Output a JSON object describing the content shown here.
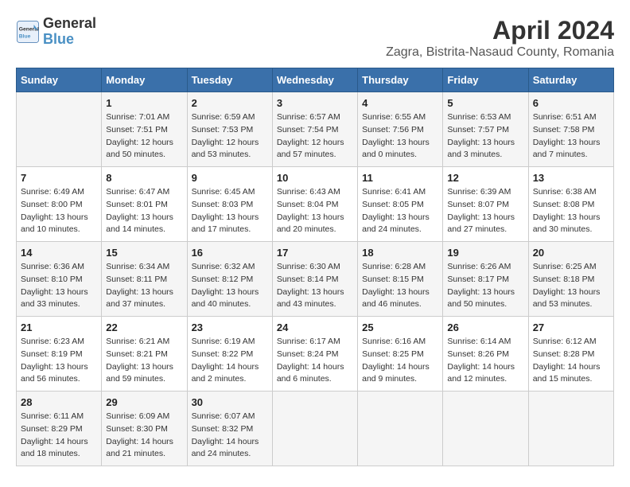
{
  "logo": {
    "name1": "General",
    "name2": "Blue"
  },
  "title": "April 2024",
  "subtitle": "Zagra, Bistrita-Nasaud County, Romania",
  "days_of_week": [
    "Sunday",
    "Monday",
    "Tuesday",
    "Wednesday",
    "Thursday",
    "Friday",
    "Saturday"
  ],
  "weeks": [
    [
      {
        "day": "",
        "detail": ""
      },
      {
        "day": "1",
        "detail": "Sunrise: 7:01 AM\nSunset: 7:51 PM\nDaylight: 12 hours\nand 50 minutes."
      },
      {
        "day": "2",
        "detail": "Sunrise: 6:59 AM\nSunset: 7:53 PM\nDaylight: 12 hours\nand 53 minutes."
      },
      {
        "day": "3",
        "detail": "Sunrise: 6:57 AM\nSunset: 7:54 PM\nDaylight: 12 hours\nand 57 minutes."
      },
      {
        "day": "4",
        "detail": "Sunrise: 6:55 AM\nSunset: 7:56 PM\nDaylight: 13 hours\nand 0 minutes."
      },
      {
        "day": "5",
        "detail": "Sunrise: 6:53 AM\nSunset: 7:57 PM\nDaylight: 13 hours\nand 3 minutes."
      },
      {
        "day": "6",
        "detail": "Sunrise: 6:51 AM\nSunset: 7:58 PM\nDaylight: 13 hours\nand 7 minutes."
      }
    ],
    [
      {
        "day": "7",
        "detail": "Sunrise: 6:49 AM\nSunset: 8:00 PM\nDaylight: 13 hours\nand 10 minutes."
      },
      {
        "day": "8",
        "detail": "Sunrise: 6:47 AM\nSunset: 8:01 PM\nDaylight: 13 hours\nand 14 minutes."
      },
      {
        "day": "9",
        "detail": "Sunrise: 6:45 AM\nSunset: 8:03 PM\nDaylight: 13 hours\nand 17 minutes."
      },
      {
        "day": "10",
        "detail": "Sunrise: 6:43 AM\nSunset: 8:04 PM\nDaylight: 13 hours\nand 20 minutes."
      },
      {
        "day": "11",
        "detail": "Sunrise: 6:41 AM\nSunset: 8:05 PM\nDaylight: 13 hours\nand 24 minutes."
      },
      {
        "day": "12",
        "detail": "Sunrise: 6:39 AM\nSunset: 8:07 PM\nDaylight: 13 hours\nand 27 minutes."
      },
      {
        "day": "13",
        "detail": "Sunrise: 6:38 AM\nSunset: 8:08 PM\nDaylight: 13 hours\nand 30 minutes."
      }
    ],
    [
      {
        "day": "14",
        "detail": "Sunrise: 6:36 AM\nSunset: 8:10 PM\nDaylight: 13 hours\nand 33 minutes."
      },
      {
        "day": "15",
        "detail": "Sunrise: 6:34 AM\nSunset: 8:11 PM\nDaylight: 13 hours\nand 37 minutes."
      },
      {
        "day": "16",
        "detail": "Sunrise: 6:32 AM\nSunset: 8:12 PM\nDaylight: 13 hours\nand 40 minutes."
      },
      {
        "day": "17",
        "detail": "Sunrise: 6:30 AM\nSunset: 8:14 PM\nDaylight: 13 hours\nand 43 minutes."
      },
      {
        "day": "18",
        "detail": "Sunrise: 6:28 AM\nSunset: 8:15 PM\nDaylight: 13 hours\nand 46 minutes."
      },
      {
        "day": "19",
        "detail": "Sunrise: 6:26 AM\nSunset: 8:17 PM\nDaylight: 13 hours\nand 50 minutes."
      },
      {
        "day": "20",
        "detail": "Sunrise: 6:25 AM\nSunset: 8:18 PM\nDaylight: 13 hours\nand 53 minutes."
      }
    ],
    [
      {
        "day": "21",
        "detail": "Sunrise: 6:23 AM\nSunset: 8:19 PM\nDaylight: 13 hours\nand 56 minutes."
      },
      {
        "day": "22",
        "detail": "Sunrise: 6:21 AM\nSunset: 8:21 PM\nDaylight: 13 hours\nand 59 minutes."
      },
      {
        "day": "23",
        "detail": "Sunrise: 6:19 AM\nSunset: 8:22 PM\nDaylight: 14 hours\nand 2 minutes."
      },
      {
        "day": "24",
        "detail": "Sunrise: 6:17 AM\nSunset: 8:24 PM\nDaylight: 14 hours\nand 6 minutes."
      },
      {
        "day": "25",
        "detail": "Sunrise: 6:16 AM\nSunset: 8:25 PM\nDaylight: 14 hours\nand 9 minutes."
      },
      {
        "day": "26",
        "detail": "Sunrise: 6:14 AM\nSunset: 8:26 PM\nDaylight: 14 hours\nand 12 minutes."
      },
      {
        "day": "27",
        "detail": "Sunrise: 6:12 AM\nSunset: 8:28 PM\nDaylight: 14 hours\nand 15 minutes."
      }
    ],
    [
      {
        "day": "28",
        "detail": "Sunrise: 6:11 AM\nSunset: 8:29 PM\nDaylight: 14 hours\nand 18 minutes."
      },
      {
        "day": "29",
        "detail": "Sunrise: 6:09 AM\nSunset: 8:30 PM\nDaylight: 14 hours\nand 21 minutes."
      },
      {
        "day": "30",
        "detail": "Sunrise: 6:07 AM\nSunset: 8:32 PM\nDaylight: 14 hours\nand 24 minutes."
      },
      {
        "day": "",
        "detail": ""
      },
      {
        "day": "",
        "detail": ""
      },
      {
        "day": "",
        "detail": ""
      },
      {
        "day": "",
        "detail": ""
      }
    ]
  ]
}
